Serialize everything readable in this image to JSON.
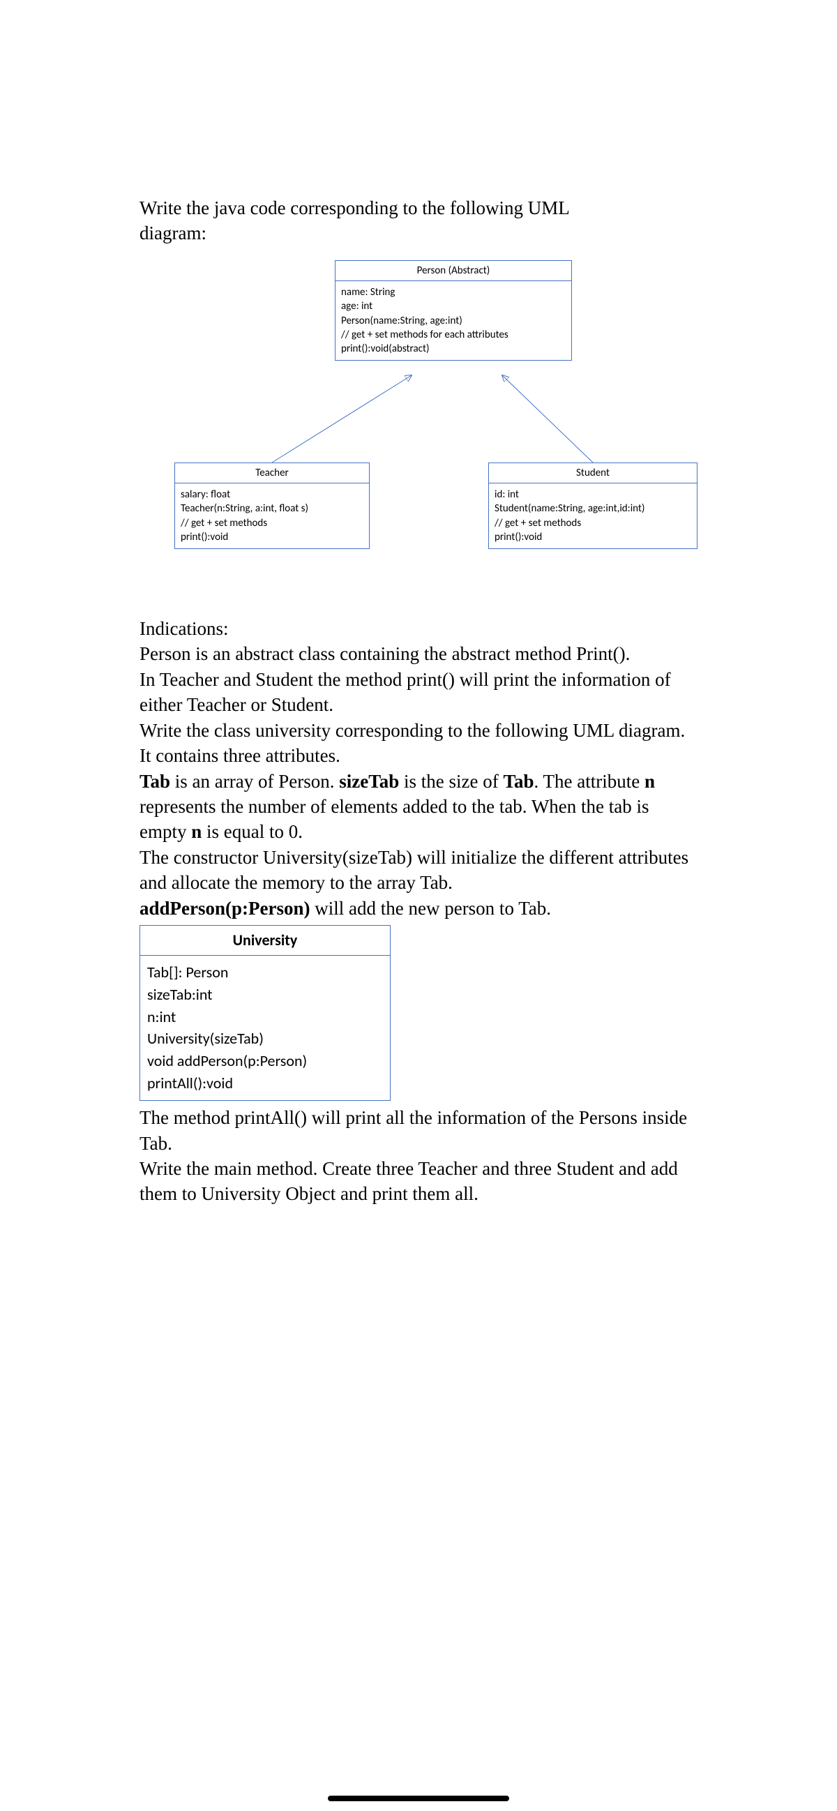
{
  "intro": {
    "line1": "Write the java code corresponding to the following UML",
    "line2": "diagram:"
  },
  "uml": {
    "person": {
      "title": "Person (Abstract)",
      "attrs": [
        "name: String",
        "age: int",
        "Person(name:String, age:int)",
        "// get + set methods for each attributes",
        "print():void(abstract)"
      ]
    },
    "teacher": {
      "title": "Teacher",
      "attrs": [
        "salary: float",
        "Teacher(n:String, a:int, float s)",
        "// get + set methods",
        "print():void"
      ]
    },
    "student": {
      "title": "Student",
      "attrs": [
        "id: int",
        "Student(name:String, age:int,id:int)",
        "// get + set methods",
        "print():void"
      ]
    }
  },
  "indications": {
    "heading": "Indications:",
    "p1": "Person is an abstract class containing the abstract method Print().",
    "p2": "In Teacher and Student the method print() will print the information of either Teacher or Student.",
    "p3": "Write the class university corresponding to the following UML diagram. It contains three attributes.",
    "p4_pre": "",
    "tab_word": "Tab",
    "p4_mid1": " is an array of Person. ",
    "sizetab_word": "sizeTab",
    "p4_mid2": " is the size of ",
    "p4_mid3": ". The attribute ",
    "n_word": "n",
    "p4_mid4": " represents the number of elements added to the tab. When the tab is empty ",
    "p4_mid5": " is equal to 0.",
    "p5": "The constructor University(sizeTab) will initialize the different attributes and allocate the memory to the array Tab.",
    "addperson_word": "addPerson(p:Person)",
    "p6_rest": " will add the new person to Tab."
  },
  "university": {
    "title": "University",
    "attrs": [
      "Tab[]: Person",
      "sizeTab:int",
      "n:int",
      "University(sizeTab)",
      "void addPerson(p:Person)",
      "printAll():void"
    ]
  },
  "footer": {
    "p1": "The method printAll() will print all the information of the Persons inside Tab.",
    "p2": "Write the main method. Create three Teacher and three Student and add them to University Object and print them all."
  }
}
